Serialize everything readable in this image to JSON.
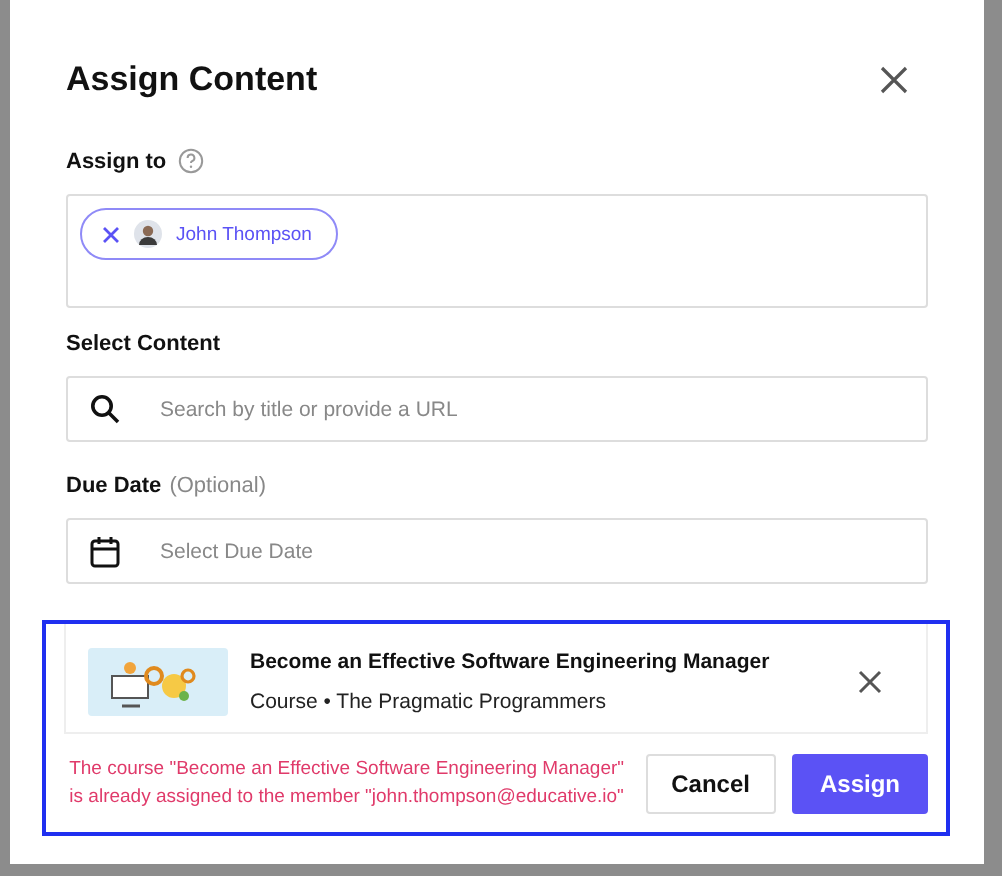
{
  "dialog": {
    "title": "Assign Content"
  },
  "assign_to": {
    "label": "Assign to",
    "chips": [
      {
        "name": "John Thompson"
      }
    ]
  },
  "select_content": {
    "label": "Select Content",
    "placeholder": "Search by title or provide a URL"
  },
  "due_date": {
    "label": "Due Date",
    "hint": "(Optional)",
    "placeholder": "Select Due Date"
  },
  "selected_course": {
    "title": "Become an Effective Software Engineering Manager",
    "meta": "Course • The Pragmatic Programmers"
  },
  "error_message": "The course \"Become an Effective Software Engineering Manager\" is already assigned to the member \"john.thompson@educative.io\"",
  "buttons": [
    {
      "label": "Cancel",
      "kind": "secondary"
    },
    {
      "label": "Assign",
      "kind": "primary"
    }
  ]
}
